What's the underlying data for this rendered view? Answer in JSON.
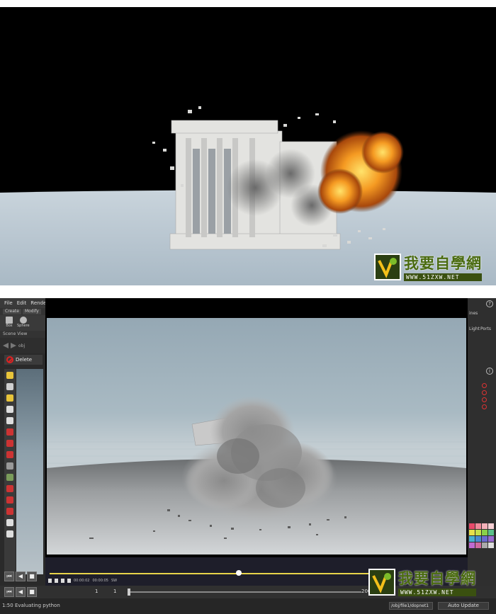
{
  "watermark": {
    "brand_cn": "我要自學網",
    "url": "WWW.51ZXW.NET"
  },
  "houdini": {
    "menu": [
      "File",
      "Edit",
      "Render"
    ],
    "shelf_tabs": [
      "Create",
      "Modify"
    ],
    "shelf_tools": [
      "Box",
      "Sphere"
    ],
    "pane_tab": "Scene View",
    "nav_path": "obj",
    "delete_label": "Delete",
    "right_panel": {
      "top_label": "ines",
      "light_label": "Light",
      "ports_label": "Ports"
    },
    "timeline": {
      "time_current": "00:00:02",
      "time_total": "00:00:05",
      "fps_label": "SW",
      "progress": 0.58
    },
    "frame_bar": {
      "start": "1",
      "current": "1",
      "end": "200"
    },
    "status_text": "1:50 Evaluating python",
    "path": "/obj/file1/dopnet1",
    "auto_update": "Auto Update"
  },
  "colors": {
    "watermark_green": "#4a6b10",
    "timeline_yellow": "#e8d44a",
    "fire_orange": "#f08a1c"
  }
}
